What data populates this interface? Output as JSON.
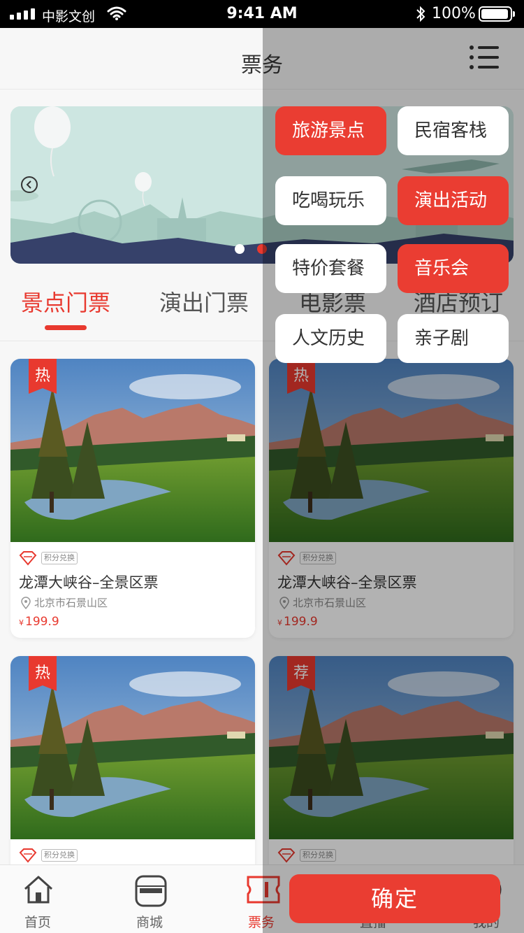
{
  "status_bar": {
    "carrier": "中影文创",
    "time": "9:41 AM",
    "battery": "100%"
  },
  "header": {
    "title": "票务",
    "menu_icon": "list-menu-icon"
  },
  "banner": {
    "dots": 2,
    "active_dot": 2
  },
  "tabs": [
    {
      "label": "景点门票",
      "active": true
    },
    {
      "label": "演出门票",
      "active": false
    },
    {
      "label": "电影票",
      "active": false
    },
    {
      "label": "酒店预订",
      "active": false
    }
  ],
  "cards": [
    {
      "badge": "热",
      "points_tag": "积分兑换",
      "name": "龙潭大峡谷–全景区票",
      "location": "北京市石景山区",
      "currency": "¥",
      "price": "199.9"
    },
    {
      "badge": "热",
      "points_tag": "积分兑换",
      "name": "龙潭大峡谷–全景区票",
      "location": "北京市石景山区",
      "currency": "¥",
      "price": "199.9"
    },
    {
      "badge": "热",
      "points_tag": "积分兑换"
    },
    {
      "badge": "荐",
      "points_tag": "积分兑换"
    }
  ],
  "bottom_nav": [
    {
      "label": "首页",
      "icon": "home-icon"
    },
    {
      "label": "商城",
      "icon": "shop-icon"
    },
    {
      "label": "票务",
      "icon": "ticket-icon",
      "active": true
    },
    {
      "label": "直播",
      "icon": "live-icon"
    },
    {
      "label": "我的",
      "icon": "profile-icon"
    }
  ],
  "filter_panel": {
    "categories": [
      {
        "label": "旅游景点",
        "selected": true
      },
      {
        "label": "民宿客栈",
        "selected": false
      },
      {
        "label": "吃喝玩乐",
        "selected": false
      },
      {
        "label": "演出活动",
        "selected": true
      },
      {
        "label": "特价套餐",
        "selected": false
      },
      {
        "label": "音乐会",
        "selected": true
      },
      {
        "label": "人文历史",
        "selected": false
      },
      {
        "label": "亲子剧",
        "selected": false
      }
    ],
    "confirm_label": "确定"
  },
  "colors": {
    "accent": "#e8392f",
    "background": "#f7f7f7"
  }
}
